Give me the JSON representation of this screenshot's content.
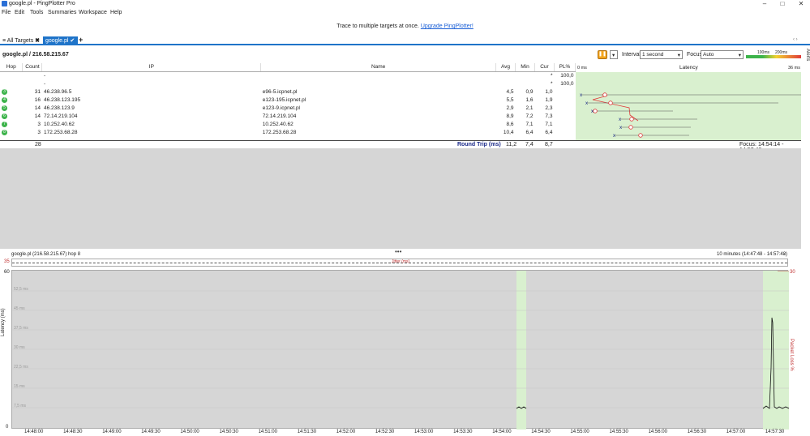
{
  "window": {
    "title": "google.pl - PingPlotter Pro",
    "min": "–",
    "max": "□",
    "close": "✕"
  },
  "menu": [
    "File",
    "Edit",
    "Tools",
    "Summaries",
    "Workspace",
    "Help"
  ],
  "banner": {
    "text": "Trace to multiple targets at once.",
    "link": "Upgrade PingPlotter!"
  },
  "tabs": {
    "all": "All Targets",
    "active": "google.pl",
    "add": "+"
  },
  "target": "google.pl / 216.58.215.67",
  "toolbar": {
    "interval_label": "Interval",
    "interval_value": "1 second",
    "focus_label": "Focus",
    "focus_value": "Auto",
    "legend_100": "100ms",
    "legend_200": "200ms",
    "alerts": "Alerts"
  },
  "table": {
    "headers": {
      "hop": "Hop",
      "count": "Count",
      "ip": "IP",
      "name": "Name",
      "avg": "Avg",
      "min": "Min",
      "cur": "Cur",
      "pl": "PL%",
      "lat0": "0 ms",
      "latency": "Latency",
      "lat_max": "36 ms"
    },
    "rows": [
      {
        "hop": "",
        "count": "",
        "ip": "-",
        "name": "",
        "avg": "",
        "min": "",
        "cur": "*",
        "pl": "100,0"
      },
      {
        "hop": "",
        "count": "",
        "ip": "-",
        "name": "",
        "avg": "",
        "min": "",
        "cur": "*",
        "pl": "100,0"
      },
      {
        "hop": "3",
        "count": "31",
        "ip": "46.238.96.5",
        "name": "e96-5.icpnet.pl",
        "avg": "4,5",
        "min": "0,9",
        "cur": "1,0",
        "pl": ""
      },
      {
        "hop": "4",
        "count": "16",
        "ip": "46.238.123.195",
        "name": "e123-195.icpnet.pl",
        "avg": "5,5",
        "min": "1,6",
        "cur": "1,9",
        "pl": ""
      },
      {
        "hop": "5",
        "count": "14",
        "ip": "46.238.123.9",
        "name": "e123-9.icpnet.pl",
        "avg": "2,9",
        "min": "2,1",
        "cur": "2,3",
        "pl": ""
      },
      {
        "hop": "6",
        "count": "14",
        "ip": "72.14.219.104",
        "name": "72.14.219.104",
        "avg": "8,9",
        "min": "7,2",
        "cur": "7,3",
        "pl": ""
      },
      {
        "hop": "7",
        "count": "3",
        "ip": "10.252.40.62",
        "name": "10.252.40.62",
        "avg": "8,6",
        "min": "7,1",
        "cur": "7,1",
        "pl": ""
      },
      {
        "hop": "8",
        "count": "3",
        "ip": "172.253.68.28",
        "name": "172.253.68.28",
        "avg": "10,4",
        "min": "6,4",
        "cur": "6,4",
        "pl": ""
      }
    ],
    "rt": {
      "count": "28",
      "label": "Round Trip (ms)",
      "avg": "11,2",
      "min": "7,4",
      "cur": "8,7",
      "focus": "Focus: 14:54:14 - 14:57:48"
    }
  },
  "graph": {
    "title": "google.pl (216.58.215.67) hop 8",
    "range": "10 minutes (14:47:48 - 14:57:48)",
    "jitter": "Jitter (ms)",
    "y_top_left": "35",
    "y_top_right": "30",
    "y_max": "60",
    "y_min": "0",
    "ylabel": "Latency (ms)",
    "ylabel_right": "Packet Loss %",
    "yticks": [
      "52,5 ms",
      "45 ms",
      "37,5 ms",
      "30 ms",
      "22,5 ms",
      "15 ms",
      "7,5 ms"
    ],
    "xticks": [
      "14:48:00",
      "14:48:30",
      "14:49:00",
      "14:49:30",
      "14:50:00",
      "14:50:30",
      "14:51:00",
      "14:51:30",
      "14:52:00",
      "14:52:30",
      "14:53:00",
      "14:53:30",
      "14:54:00",
      "14:54:30",
      "14:55:00",
      "14:55:30",
      "14:56:00",
      "14:56:30",
      "14:57:00",
      "14:57:30"
    ]
  }
}
